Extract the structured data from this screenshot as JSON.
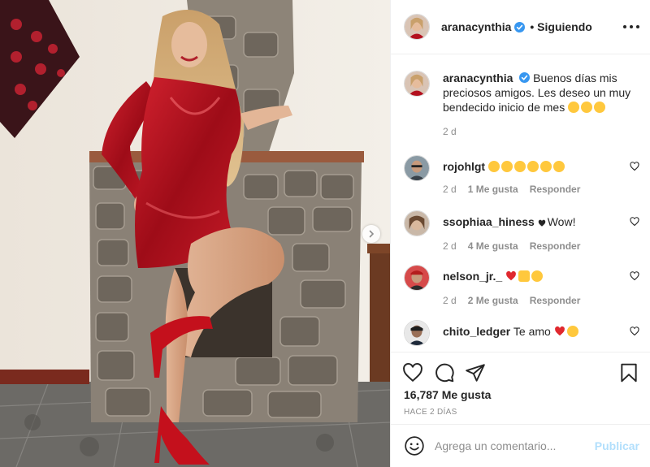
{
  "post": {
    "username": "aranacynthia",
    "follow_label": "Siguiendo",
    "caption_text": "Buenos días mis preciosos amigos. Les deseo un muy bendecido inicio de mes",
    "caption_time": "2 d"
  },
  "comments": [
    {
      "username": "rojohlgt",
      "text": "",
      "time": "2 d",
      "likes": "1 Me gusta",
      "reply": "Responder"
    },
    {
      "username": "ssophiaa_hiness",
      "text": "Wow!",
      "time": "2 d",
      "likes": "4 Me gusta",
      "reply": "Responder"
    },
    {
      "username": "nelson_jr._",
      "text": "",
      "time": "2 d",
      "likes": "2 Me gusta",
      "reply": "Responder"
    },
    {
      "username": "chito_ledger",
      "text": "Te amo",
      "time": "",
      "likes": "",
      "reply": ""
    }
  ],
  "stats": {
    "likes_label": "16,787 Me gusta",
    "posted_ago": "HACE 2 DÍAS"
  },
  "composer": {
    "placeholder": "Agrega un comentario...",
    "publish_label": "Publicar"
  },
  "colors": {
    "dress": "#b3101e",
    "verified": "#3897f0",
    "publish_disabled": "#b2dffc"
  },
  "icons": [
    "verified-badge-icon",
    "more-options-icon",
    "next-arrow-icon",
    "heart-icon",
    "comment-icon",
    "share-icon",
    "bookmark-icon",
    "emoji-icon"
  ]
}
